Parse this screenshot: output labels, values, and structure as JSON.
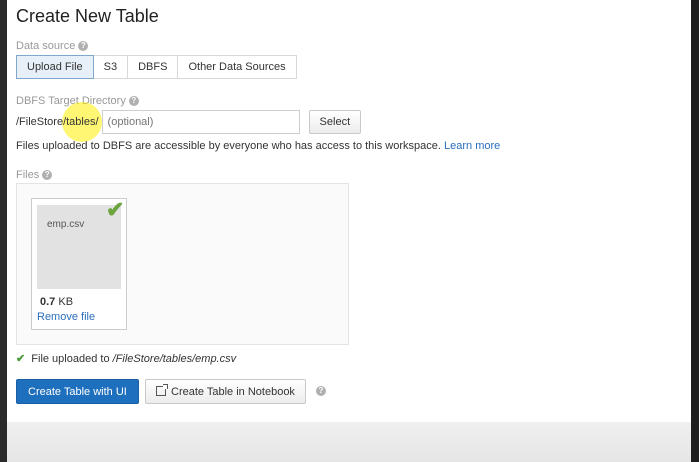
{
  "page": {
    "title": "Create New Table"
  },
  "data_source": {
    "label": "Data source",
    "tabs": [
      "Upload File",
      "S3",
      "DBFS",
      "Other Data Sources"
    ],
    "active": "Upload File"
  },
  "target_dir": {
    "label": "DBFS Target Directory",
    "prefix": "/FileStore/tables/",
    "placeholder": "(optional)",
    "select_label": "Select",
    "info_text": "Files uploaded to DBFS are accessible by everyone who has access to this workspace.",
    "learn_more": "Learn more"
  },
  "files": {
    "label": "Files",
    "file_name": "emp.csv",
    "size_value": "0.7",
    "size_unit": "KB",
    "remove_label": "Remove file"
  },
  "status": {
    "text": "File uploaded to",
    "path": "/FileStore/tables/emp.csv"
  },
  "actions": {
    "create_ui": "Create Table with UI",
    "create_notebook": "Create Table in Notebook"
  },
  "icons": {
    "help": "help-icon",
    "check": "check-icon",
    "external": "external-link-icon"
  },
  "colors": {
    "primary": "#1e6fbd",
    "link": "#2a6ebb",
    "success": "#6ba33c"
  }
}
